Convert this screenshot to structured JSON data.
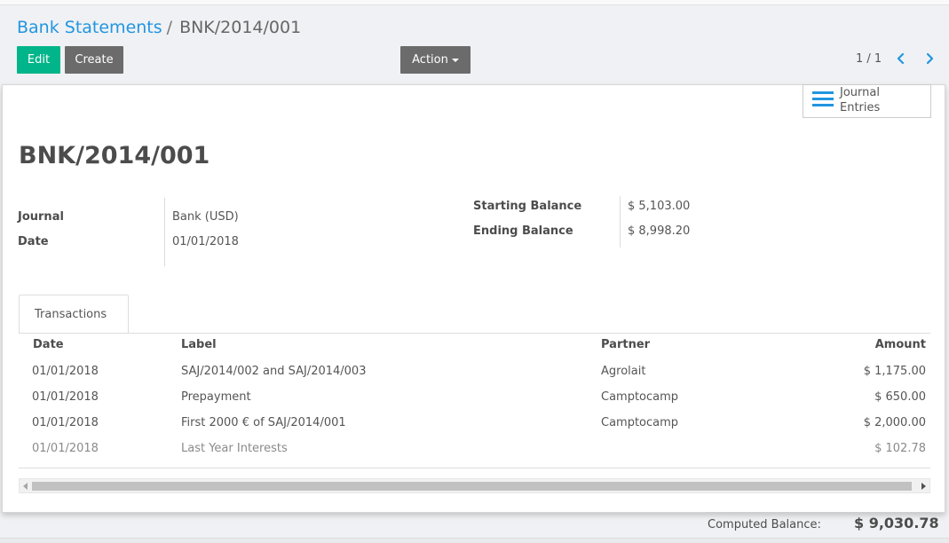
{
  "breadcrumb": {
    "parent": "Bank Statements",
    "separator": "/",
    "current": "BNK/2014/001"
  },
  "toolbar": {
    "edit_label": "Edit",
    "create_label": "Create",
    "action_label": "Action"
  },
  "pager": {
    "value": "1 / 1"
  },
  "smart_button": {
    "line1": "Journal",
    "line2": "Entries",
    "icon": "list-icon"
  },
  "record": {
    "title": "BNK/2014/001"
  },
  "fields": {
    "journal_label": "Journal",
    "journal_value": "Bank (USD)",
    "date_label": "Date",
    "date_value": "01/01/2018",
    "starting_label": "Starting Balance",
    "starting_value": "$ 5,103.00",
    "ending_label": "Ending Balance",
    "ending_value": "$ 8,998.20"
  },
  "tabs": [
    {
      "label": "Transactions"
    }
  ],
  "table": {
    "columns": [
      "Date",
      "Label",
      "Partner",
      "Amount"
    ],
    "rows": [
      {
        "date": "01/01/2018",
        "label": "SAJ/2014/002 and SAJ/2014/003",
        "partner": "Agrolait",
        "amount": "$ 1,175.00"
      },
      {
        "date": "01/01/2018",
        "label": "Prepayment",
        "partner": "Camptocamp",
        "amount": "$ 650.00"
      },
      {
        "date": "01/01/2018",
        "label": "First 2000 € of SAJ/2014/001",
        "partner": "Camptocamp",
        "amount": "$ 2,000.00"
      },
      {
        "date": "01/01/2018",
        "label": "Last Year Interests",
        "partner": "",
        "amount": "$ 102.78"
      }
    ]
  },
  "footer": {
    "computed_label": "Computed Balance:",
    "computed_value": "$ 9,030.78"
  },
  "colors": {
    "primary": "#00b58a",
    "link": "#2196e0",
    "secondary": "#6b6b6b"
  }
}
